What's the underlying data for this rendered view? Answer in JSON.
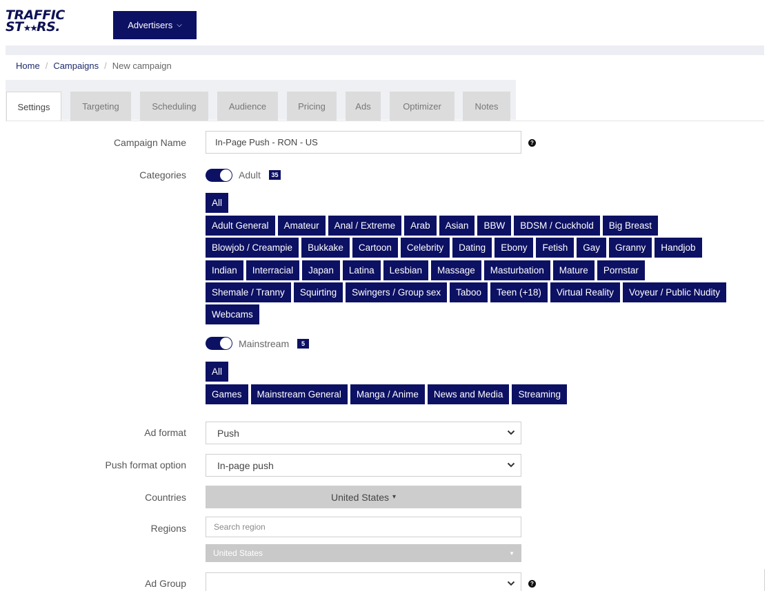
{
  "header": {
    "logo_line1": "TRAFFIC",
    "logo_line2_a": "ST",
    "logo_line2_stars": "★★",
    "logo_line2_b": "RS",
    "logo_line2_dot": ".",
    "role_button": "Advertisers",
    "role_chevron": "⌵"
  },
  "breadcrumb": {
    "home": "Home",
    "campaigns": "Campaigns",
    "current": "New campaign",
    "sep": "/"
  },
  "tabs": [
    {
      "label": "Settings",
      "active": true
    },
    {
      "label": "Targeting"
    },
    {
      "label": "Scheduling"
    },
    {
      "label": "Audience"
    },
    {
      "label": "Pricing"
    },
    {
      "label": "Ads"
    },
    {
      "label": "Optimizer"
    },
    {
      "label": "Notes"
    }
  ],
  "form": {
    "campaign_name_label": "Campaign Name",
    "campaign_name_value": "In-Page Push - RON - US",
    "categories_label": "Categories",
    "adult": {
      "label": "Adult",
      "count": "35",
      "all": "All",
      "rows": [
        [
          "Adult General",
          "Amateur",
          "Anal / Extreme",
          "Arab",
          "Asian",
          "BBW",
          "BDSM / Cuckhold",
          "Big Breast"
        ],
        [
          "Blowjob / Creampie",
          "Bukkake",
          "Cartoon",
          "Celebrity",
          "Dating",
          "Ebony",
          "Fetish",
          "Gay",
          "Granny",
          "Handjob"
        ],
        [
          "Indian",
          "Interracial",
          "Japan",
          "Latina",
          "Lesbian",
          "Massage",
          "Masturbation",
          "Mature",
          "Pornstar"
        ],
        [
          "Shemale / Tranny",
          "Squirting",
          "Swingers / Group sex",
          "Taboo",
          "Teen (+18)",
          "Virtual Reality",
          "Voyeur / Public Nudity"
        ],
        [
          "Webcams"
        ]
      ]
    },
    "mainstream": {
      "label": "Mainstream",
      "count": "5",
      "all": "All",
      "rows": [
        [
          "Games",
          "Mainstream General",
          "Manga / Anime",
          "News and Media",
          "Streaming"
        ]
      ]
    },
    "ad_format_label": "Ad format",
    "ad_format_value": "Push",
    "push_format_label": "Push format option",
    "push_format_value": "In-page push",
    "countries_label": "Countries",
    "countries_value": "United States",
    "countries_caret": "▾",
    "regions_label": "Regions",
    "regions_placeholder": "Search region",
    "regions_group": "United States",
    "regions_caret": "▼",
    "ad_group_label": "Ad Group",
    "ad_group_value": ""
  },
  "colors": {
    "brand_navy": "#0d1163",
    "tab_inactive_bg": "#dcdcdc"
  }
}
